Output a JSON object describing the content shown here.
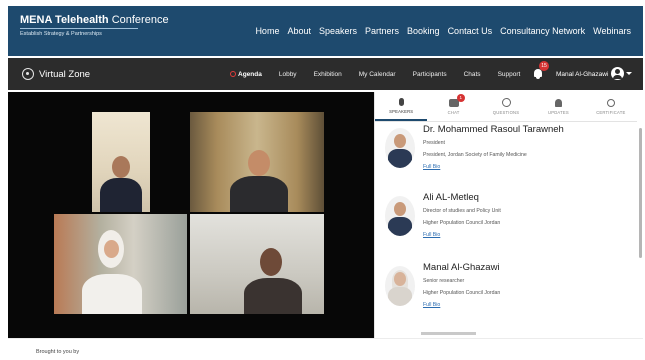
{
  "header": {
    "brand_name": "MENA Telehealth",
    "brand_suffix": "Conference",
    "brand_tagline": "Establish Strategy & Partnerships",
    "nav": [
      "Home",
      "About",
      "Speakers",
      "Partners",
      "Booking",
      "Contact Us",
      "Consultancy Network",
      "Webinars"
    ]
  },
  "subbar": {
    "zone_label": "Virtual Zone",
    "nav": [
      "Agenda",
      "Lobby",
      "Exhibition",
      "My Calendar",
      "Participants",
      "Chats",
      "Support"
    ],
    "active": "Agenda",
    "notification_count": "15",
    "user_name": "Manal Al-Ghazawi"
  },
  "panel": {
    "tabs": [
      {
        "label": "SPEAKERS",
        "icon": "mic-icon",
        "active": true
      },
      {
        "label": "CHAT",
        "icon": "chat-icon",
        "badge": "1"
      },
      {
        "label": "QUESTIONS",
        "icon": "question-icon"
      },
      {
        "label": "UPDATES",
        "icon": "bell-icon"
      },
      {
        "label": "CERTIFICATE",
        "icon": "certificate-icon"
      }
    ],
    "speakers": [
      {
        "name": "Dr. Mohammed Rasoul Tarawneh",
        "title": "President",
        "org": "President, Jordan Society of Family Medicine",
        "bio_link": "Full Bio"
      },
      {
        "name": "Ali AL-Metleq",
        "title": "Director of studies and Policy Unit",
        "org": "Higher Population Council Jordan",
        "bio_link": "Full Bio"
      },
      {
        "name": "Manal Al-Ghazawi",
        "title": "Senior researcher",
        "org": "Higher Population Council Jordan",
        "bio_link": "Full Bio"
      }
    ]
  },
  "footer": {
    "text": "Brought to you by"
  }
}
